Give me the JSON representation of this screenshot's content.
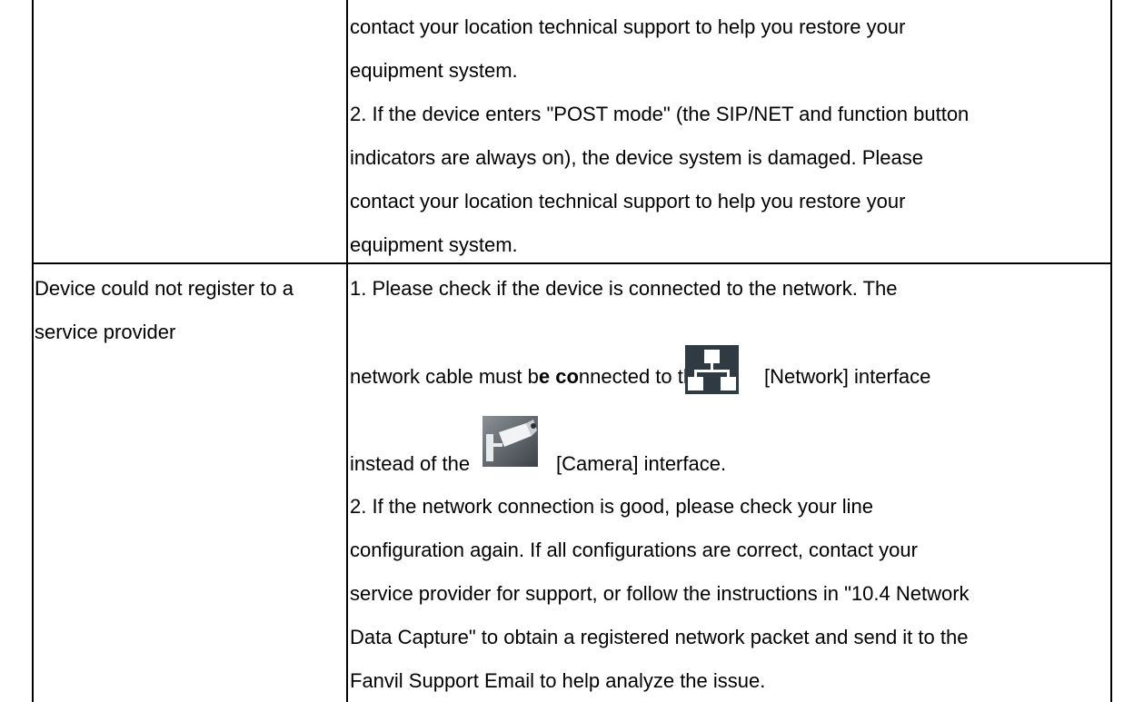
{
  "rows": [
    {
      "issue": "",
      "solution_lines": [
        "contact your location technical support to help you restore your",
        "equipment system.",
        "2. If the device enters \"POST mode\" (the SIP/NET and function button",
        "indicators are always on), the device system is damaged. Please",
        "contact your location technical support to help you restore your",
        "equipment system."
      ]
    },
    {
      "issue_lines": [
        "Device could not register to a",
        "service provider"
      ],
      "solution": {
        "line1": "1. Please check if the device is connected to the network. The",
        "line2_pre": "network cable must b",
        "line2_bold": "e co",
        "line2_mid": "nnected to the",
        "line2_post": "[Network] interface",
        "line3_pre": "instead of the",
        "line3_post": "[Camera] interface.",
        "lines_after": [
          "2. If the network connection is good, please check your line",
          "configuration again. If all configurations are correct, contact your",
          "service provider for support, or follow the instructions in \"10.4 Network",
          "Data Capture\" to obtain a registered network packet and send it to the",
          "Fanvil Support Email to help analyze the issue."
        ]
      }
    }
  ],
  "icons": {
    "network": "network-icon",
    "camera": "camera-icon"
  }
}
